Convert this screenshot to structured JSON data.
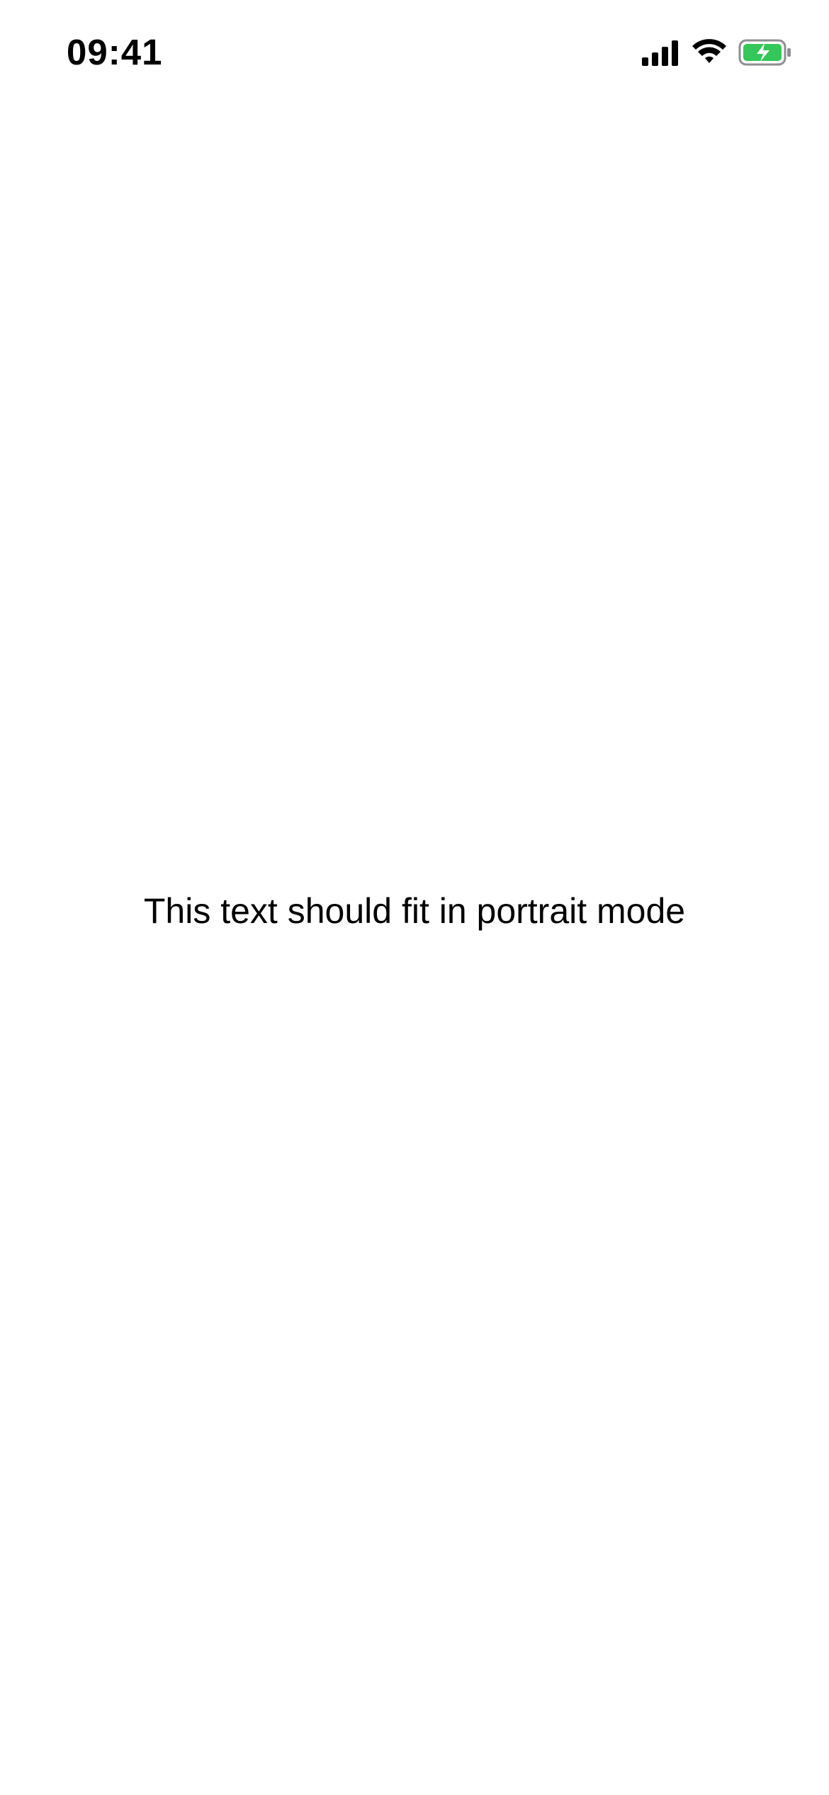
{
  "status_bar": {
    "time": "09:41",
    "icons": {
      "signal": "cellular-signal-icon",
      "wifi": "wifi-icon",
      "battery": "battery-charging-icon"
    },
    "battery_color": "#34C759"
  },
  "main": {
    "text": "This text should fit in portrait mode"
  }
}
